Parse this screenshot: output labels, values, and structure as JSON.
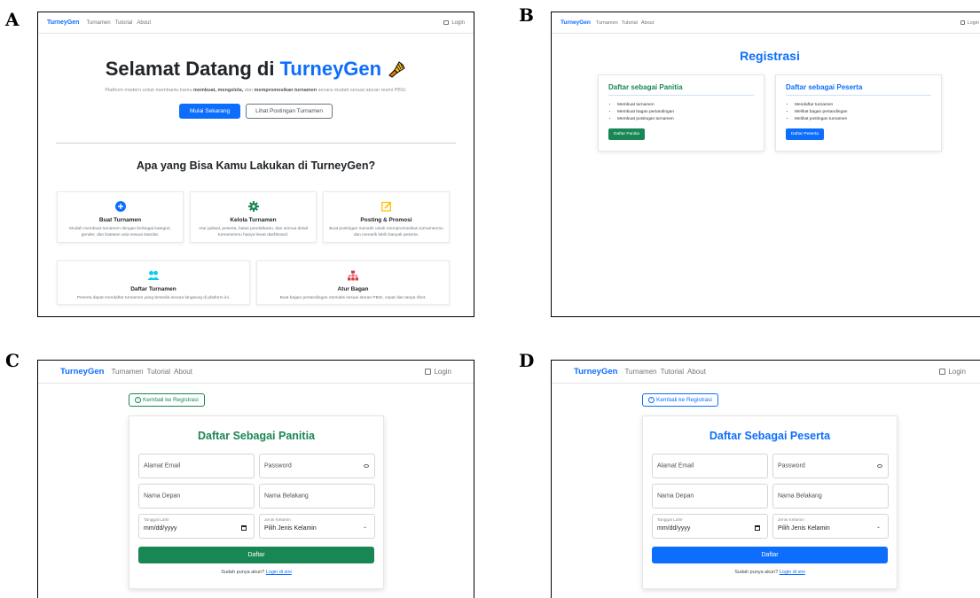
{
  "labels": {
    "a": "A",
    "b": "B",
    "c": "C",
    "d": "D"
  },
  "nav": {
    "brand": "TurneyGen",
    "links": [
      "Turnamen",
      "Tutorial",
      "About"
    ],
    "login": "Login"
  },
  "panel_a": {
    "hero_title_prefix": "Selamat Datang di",
    "hero_title_brand": "TurneyGen",
    "hero_sub_1": "Platform modern untuk membantu kamu ",
    "hero_sub_b1": "membuat, mengelola,",
    "hero_sub_2": " dan ",
    "hero_sub_b2": "mempromosikan turnamen",
    "hero_sub_3": " secara mudah sesuai aturan resmi PBSI.",
    "primary_button": "Mulai Sekarang",
    "secondary_button": "Lihat Postingan Turnamen",
    "section_title": "Apa yang Bisa Kamu Lakukan di TurneyGen?",
    "features": [
      {
        "title": "Buat Turnamen",
        "desc": "Mudah membuat turnamen dengan berbagai kategori, gender, dan batasan usia sesuai standar.",
        "icon": "plus-circle-icon",
        "color": "#0d6efd"
      },
      {
        "title": "Kelola Turnamen",
        "desc": "Atur jadwal, peserta, batas pendaftaran, dan semua detail turnamenmu hanya lewat dashboard.",
        "icon": "gear-icon",
        "color": "#198754"
      },
      {
        "title": "Posting & Promosi",
        "desc": "Buat postingan menarik untuk mempromosikan turnamenmu dan menarik lebih banyak peserta.",
        "icon": "edit-icon",
        "color": "#ffc107"
      },
      {
        "title": "Daftar Turnamen",
        "desc": "Peserta dapat mendaftar turnamen yang tersedia secara langsung di platform ini.",
        "icon": "people-icon",
        "color": "#0dcaf0"
      },
      {
        "title": "Atur Bagan",
        "desc": "Buat bagan pertandingan otomatis sesuai aturan PBSI, cepat dan tanpa ribet.",
        "icon": "diagram-icon",
        "color": "#dc3545"
      }
    ]
  },
  "panel_b": {
    "title": "Registrasi",
    "panitia": {
      "title": "Daftar sebagai Panitia",
      "items": [
        "Membuat turnamen",
        "Membuat bagan pertandingan",
        "Membuat postingan turnamen"
      ],
      "button": "Daftar Panitia",
      "color": "#198754"
    },
    "peserta": {
      "title": "Daftar sebagai Peserta",
      "items": [
        "Mendaftar turnamen",
        "Melihat bagan pertandingan",
        "Melihat postingan turnamen"
      ],
      "button": "Daftar Peserta",
      "color": "#0d6efd"
    }
  },
  "form": {
    "back": "Kembali ke Registrasi",
    "email": "Alamat Email",
    "password": "Password",
    "first_name": "Nama Depan",
    "last_name": "Nama Belakang",
    "dob_label": "Tanggal Lahir",
    "dob_value": "mm/dd/yyyy",
    "gender_label": "Jenis Kelamin",
    "gender_value": "Pilih Jenis Kelamin",
    "submit": "Daftar",
    "have_account": "Sudah punya akun?",
    "login_link": "Login di sini"
  },
  "panel_c": {
    "title": "Daftar Sebagai Panitia",
    "accent": "#198754"
  },
  "panel_d": {
    "title": "Daftar Sebagai Peserta",
    "accent": "#0d6efd"
  }
}
